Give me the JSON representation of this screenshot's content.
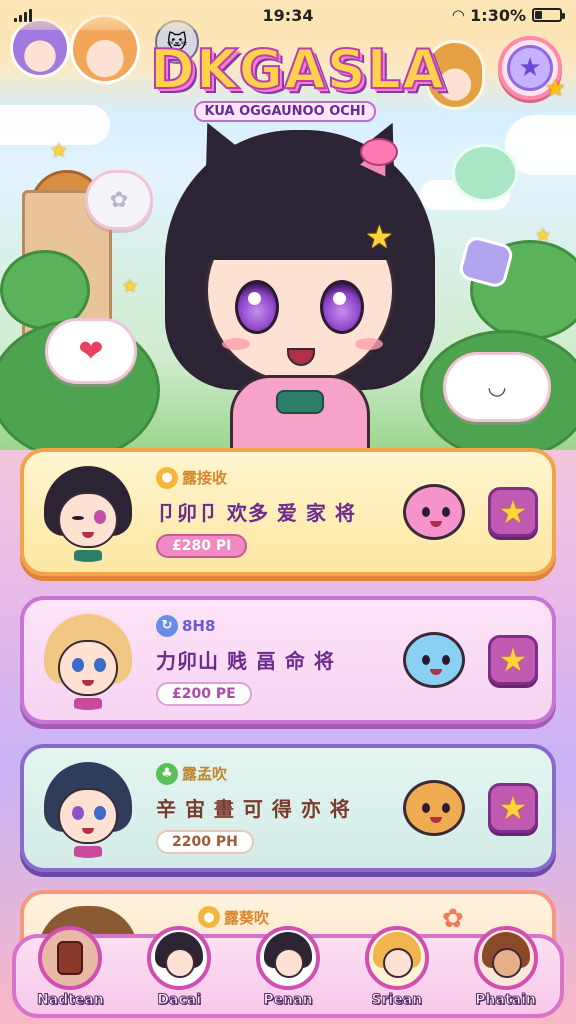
{
  "status_bar": {
    "time": "19:34",
    "battery_text": "1:30%",
    "battery_level_percent": 30
  },
  "header": {
    "logo_text": "DKGASLA",
    "logo_subtitle": "KUA OGGAUNOO OCHI",
    "favorite_button_icon": "star-icon"
  },
  "hero": {
    "bubbles": [
      "heart-bubble",
      "smile-bubble",
      "chick-bubble"
    ]
  },
  "cards": [
    {
      "tag": "露接收",
      "title": "卩卯卩 欢多 爱 家 将",
      "price": "£280 PI",
      "accent": "#f3a34a",
      "icon": "star-icon"
    },
    {
      "tag": "8H8",
      "title": "力卯山 贱 畐 命 将",
      "price": "£200 PE",
      "accent": "#c774d5",
      "icon": "star-icon"
    },
    {
      "tag": "露孟吹",
      "title": "辛 宙 畫 可 得 亦 将",
      "price": "2200 PH",
      "accent": "#8a6ac9",
      "icon": "star-icon"
    },
    {
      "tag": "露葵吹",
      "title": "",
      "price": "",
      "accent": "#f39a7e",
      "icon": "star-icon"
    }
  ],
  "bottom_nav": [
    {
      "label": "Nadtean",
      "icon": "food-icon"
    },
    {
      "label": "Dacai",
      "icon": "avatar-icon"
    },
    {
      "label": "Penan",
      "icon": "avatar-icon"
    },
    {
      "label": "Sriean",
      "icon": "fox-icon"
    },
    {
      "label": "Phatain",
      "icon": "bear-icon"
    }
  ]
}
